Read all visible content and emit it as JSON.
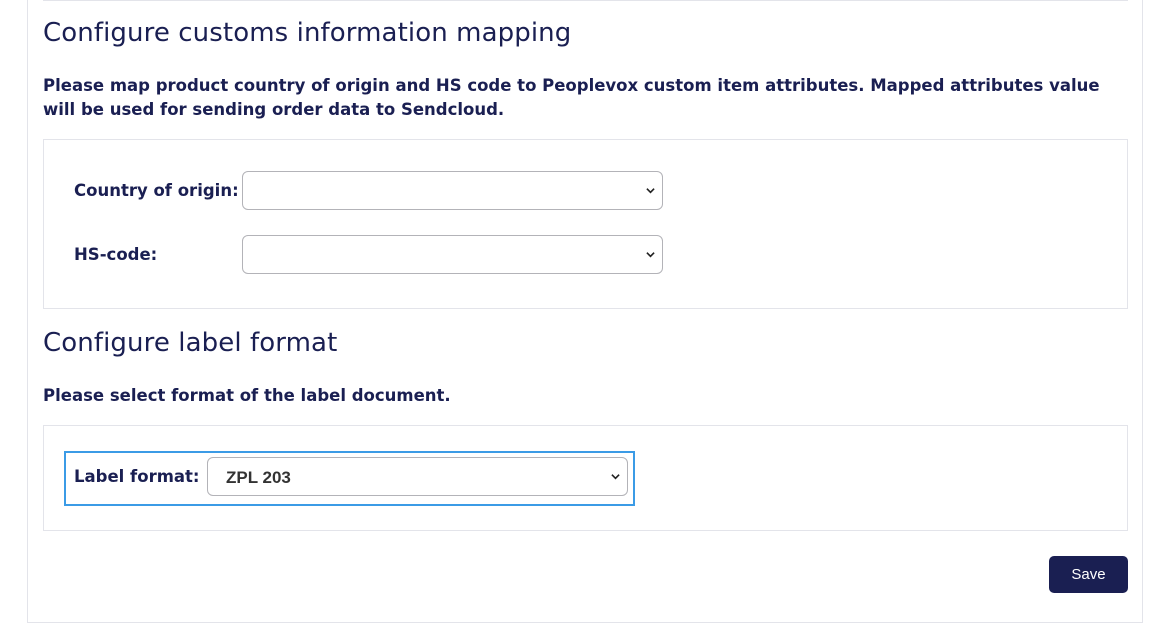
{
  "customs": {
    "title": "Configure customs information mapping",
    "description": "Please map product country of origin and HS code to Peoplevox custom item attributes. Mapped attributes value will be used for sending order data to Sendcloud.",
    "country_label": "Country of origin:",
    "country_value": "",
    "hs_label": "HS-code:",
    "hs_value": ""
  },
  "label_format": {
    "title": "Configure label format",
    "description": "Please select format of the label document.",
    "field_label": "Label format:",
    "selected_value": "ZPL 203"
  },
  "actions": {
    "save_label": "Save"
  },
  "colors": {
    "text_primary": "#1a1f52",
    "button_bg": "#1a1f52",
    "focus_outline": "#3b9be6",
    "border": "#e3e4ea"
  }
}
